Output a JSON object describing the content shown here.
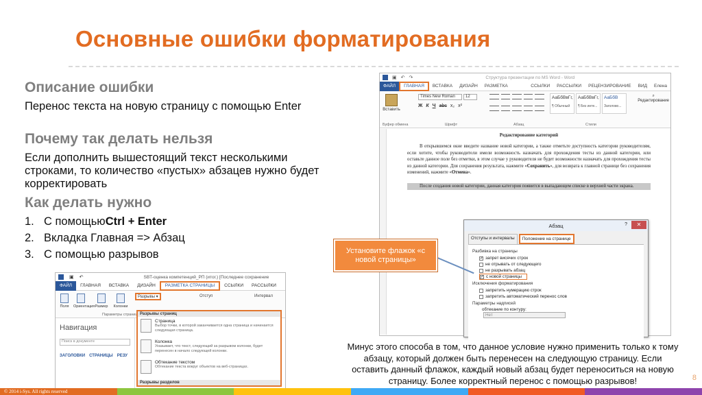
{
  "slide": {
    "title": "Основные ошибки форматирования",
    "h_description": "Описание ошибки",
    "description": "Перенос текста на новую страницу с помощью Enter",
    "h_why": "Почему так делать нельзя",
    "why": "Если дополнить вышестоящий текст несколькими строками, то количество «пустых» абзацев нужно будет корректировать",
    "h_how": "Как делать нужно",
    "how_items": [
      {
        "num": "1.",
        "pre": "С помощью ",
        "kbd": "Ctrl + Enter"
      },
      {
        "num": "2.",
        "pre": "Вкладка Главная => Абзац",
        "kbd": ""
      },
      {
        "num": "3.",
        "pre": "С помощью разрывов",
        "kbd": ""
      }
    ],
    "callout": "Установите флажок «с новой страницы»",
    "bottom_note": "Минус этого способа в том, что данное условие нужно применить только к тому абзацу, который должен быть перенесен на следующую страницу. Если оставить данный флажок, каждый новый абзац будет переноситься на новую страницу. Более корректный перенос с помощью разрывов!",
    "page_number": "8",
    "copyright": "© 2014 i-Sys. All rights reserved",
    "accent_color": "#e26c22",
    "footer_colors": [
      "#e26c22",
      "#8dc63f",
      "#ffc20e",
      "#3fa9f5",
      "#f15a24",
      "#8e44ad"
    ]
  },
  "word1": {
    "window_title": "Структура презентации по MS Word - Word",
    "tabs": [
      "ФАЙЛ",
      "ГЛАВНАЯ",
      "ВСТАВКА",
      "ДИЗАЙН",
      "РАЗМЕТКА СТРАНИЦЫ",
      "ССЫЛКИ",
      "РАССЫЛКИ",
      "РЕЦЕНЗИРОВАНИЕ",
      "ВИД",
      "Елена"
    ],
    "paste_label": "Вставить",
    "font_name": "Times New Roman",
    "font_size": "12",
    "format_buttons": [
      "Ж",
      "К",
      "Ч",
      "abc",
      "x₂",
      "x²"
    ],
    "group_labels": [
      "Буфер обмена",
      "Шрифт",
      "Абзац",
      "Стили"
    ],
    "style_tiles": [
      {
        "sample": "АаБбВвГг,",
        "name": "¶ Обычный"
      },
      {
        "sample": "АаБбВвГг,",
        "name": "¶ Без инте..."
      },
      {
        "sample": "АаБбВ",
        "name": "Заголово..."
      }
    ],
    "editing_label": "Редактирование",
    "doc_heading": "Редактирование категорий",
    "doc_p1_pre": "В открывшемся окне введите название новой категории, а также отметьте доступность категории руководителям, если хотите, чтобы руководители имели возможность назначать для прохождения тесты из данной категории, или оставьте данное поле без отметки, в этом случае у руководителя не будет возможности назначать для прохождения тесты из данной категории. Для сохранения результата, нажмите «",
    "doc_p1_b1": "Сохранить",
    "doc_p1_mid": "», для возврата к главной странице без сохранения изменений, нажмите «",
    "doc_p1_b2": "Отмена",
    "doc_p1_end": "».",
    "doc_p2": "После создания новой категории, данная категория появится в выпадающем списке в верхней части экрана."
  },
  "dialog": {
    "title": "Абзац",
    "help": "?",
    "close": "✕",
    "tabs": [
      "Отступы и интервалы",
      "Положение на странице"
    ],
    "sec_pagination": "Разбивка на страницы",
    "checks": [
      {
        "label": "запрет висячих строк",
        "checked": "✓"
      },
      {
        "label": "не отрывать от следующего",
        "checked": ""
      },
      {
        "label": "не разрывать абзац",
        "checked": ""
      },
      {
        "label": "с новой страницы",
        "checked": "✓"
      }
    ],
    "sec_exceptions": "Исключения форматирования",
    "exc_checks": [
      "запретить нумерацию строк",
      "запретить автоматический перенос слов"
    ],
    "sec_textbox": "Параметры надписей",
    "wrap_label": "обтекание по контуру:",
    "wrap_value": "Нет"
  },
  "word2": {
    "window_title": "SBT-оценка компетенций_РП (итог.) [Последнее сохранение",
    "tabs": [
      "ФАЙЛ",
      "ГЛАВНАЯ",
      "ВСТАВКА",
      "ДИЗАЙН",
      "РАЗМЕТКА СТРАНИЦЫ",
      "ССЫЛКИ",
      "РАССЫЛКИ"
    ],
    "tools": [
      "Поля",
      "Ориентация",
      "Размер",
      "Колонки"
    ],
    "breaks_button": "Разрывы ▾",
    "indent_label": "Отступ",
    "spacing_label": "Интервал",
    "group_label": "Параметры страницы",
    "nav_title": "Навигация",
    "nav_search": "Поиск в документе",
    "nav_tabs": [
      "ЗАГОЛОВКИ",
      "СТРАНИЦЫ",
      "РЕЗУ"
    ],
    "menu_header": "Разрывы страниц",
    "menu_items": [
      {
        "title": "Страница",
        "desc": "Выбор точки, в которой заканчивается одна страница и начинается следующая страница."
      },
      {
        "title": "Колонка",
        "desc": "Указывает, что текст, следующий за разрывом колонки, будет перенесен в начало следующей колонки."
      },
      {
        "title": "Обтекание текстом",
        "desc": "Обтекание текста вокруг объектов на веб-страницах."
      }
    ],
    "menu_footer": "Разрывы разделов"
  }
}
